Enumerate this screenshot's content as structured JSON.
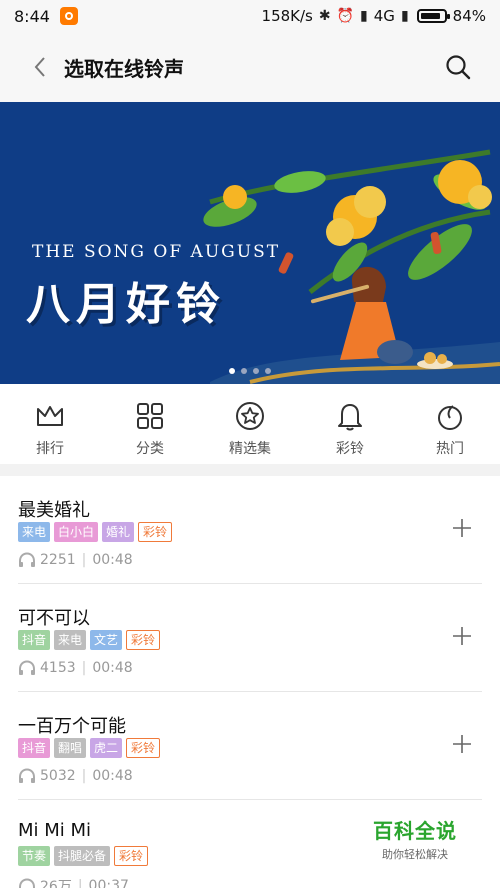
{
  "status_bar": {
    "time": "8:44",
    "network_speed": "158K/s",
    "network_type": "4G",
    "battery": "84%",
    "icons": [
      "app-notification-icon",
      "bluetooth-icon",
      "alarm-icon",
      "signal-icon",
      "battery-icon"
    ]
  },
  "header": {
    "title": "选取在线铃声",
    "back_icon": "chevron-left-icon",
    "search_icon": "search-icon"
  },
  "banner": {
    "subtitle": "THE SONG OF AUGUST",
    "title": "八月好铃",
    "slide_count": 4,
    "active_slide": 1
  },
  "categories": [
    {
      "label": "排行",
      "icon": "crown-icon"
    },
    {
      "label": "分类",
      "icon": "grid-icon"
    },
    {
      "label": "精选集",
      "icon": "star-circle-icon"
    },
    {
      "label": "彩铃",
      "icon": "bell-icon"
    },
    {
      "label": "热门",
      "icon": "flame-icon"
    }
  ],
  "songs": [
    {
      "title": "最美婚礼",
      "tags": [
        {
          "text": "来电",
          "color": "#8db8ea"
        },
        {
          "text": "白小白",
          "color": "#e89ad6"
        },
        {
          "text": "婚礼",
          "color": "#c8a6e6"
        },
        {
          "text": "彩铃",
          "color": "outline"
        }
      ],
      "plays": "2251",
      "duration": "00:48"
    },
    {
      "title": "可不可以",
      "tags": [
        {
          "text": "抖音",
          "color": "#9fd3a0"
        },
        {
          "text": "来电",
          "color": "#bdbdbd"
        },
        {
          "text": "文艺",
          "color": "#8db8ea"
        },
        {
          "text": "彩铃",
          "color": "outline"
        }
      ],
      "plays": "4153",
      "duration": "00:48"
    },
    {
      "title": "一百万个可能",
      "tags": [
        {
          "text": "抖音",
          "color": "#e89ad6"
        },
        {
          "text": "翻唱",
          "color": "#bdbdbd"
        },
        {
          "text": "虎二",
          "color": "#c8a6e6"
        },
        {
          "text": "彩铃",
          "color": "outline"
        }
      ],
      "plays": "5032",
      "duration": "00:48"
    },
    {
      "title": "Mi Mi Mi",
      "tags": [
        {
          "text": "节奏",
          "color": "#9fd3a0"
        },
        {
          "text": "抖腿必备",
          "color": "#bdbdbd"
        },
        {
          "text": "彩铃",
          "color": "outline"
        }
      ],
      "plays": "26万",
      "duration": "00:37"
    }
  ],
  "watermark": {
    "brand": "百科全说",
    "tagline": "助你轻松解决"
  },
  "colors": {
    "banner_bg": "#0f3d86",
    "accent_orange": "#f07a3a",
    "header_bg": "#f7f7f7"
  }
}
